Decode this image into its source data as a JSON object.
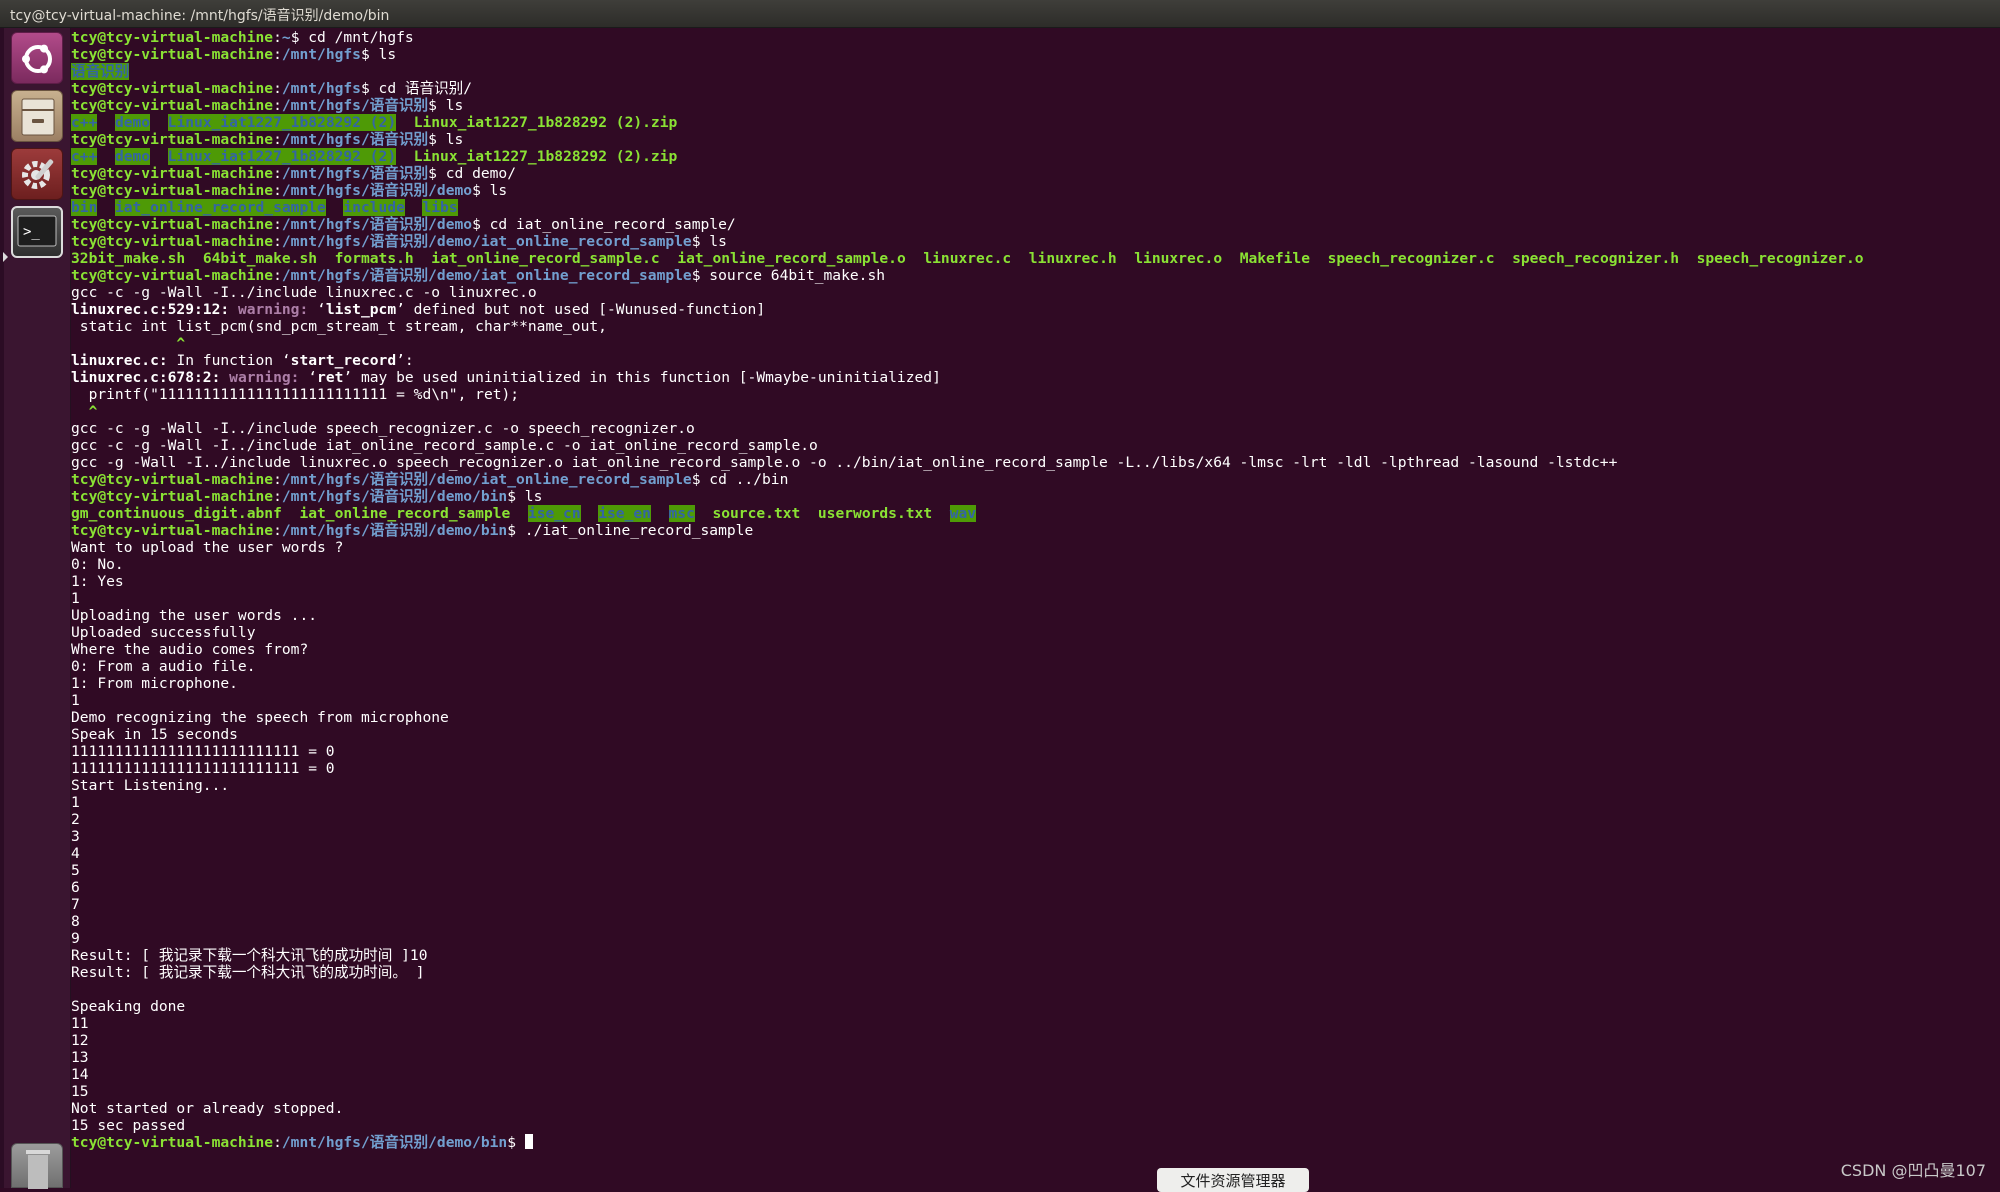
{
  "window": {
    "title": "tcy@tcy-virtual-machine: /mnt/hgfs/语音识别/demo/bin"
  },
  "launcher": {
    "items": [
      "Dash",
      "Files",
      "System Settings",
      "Terminal",
      "Trash"
    ]
  },
  "terminal": {
    "user": "tcy@tcy-virtual-machine",
    "lines": [
      [
        [
          "pu",
          "tcy@tcy-virtual-machine"
        ],
        [
          "",
          ""
        ],
        [
          "pp",
          "~"
        ],
        [
          "",
          "$ cd /mnt/hgfs"
        ]
      ],
      [
        [
          "pu",
          "tcy@tcy-virtual-machine"
        ],
        [
          "",
          ":"
        ],
        [
          "pp",
          "/mnt/hgfs"
        ],
        [
          "",
          "$ ls"
        ]
      ],
      [
        [
          "dirhl",
          "语音识别"
        ]
      ],
      [
        [
          "pu",
          "tcy@tcy-virtual-machine"
        ],
        [
          "",
          ":"
        ],
        [
          "pp",
          "/mnt/hgfs"
        ],
        [
          "",
          "$ cd 语音识别/"
        ]
      ],
      [
        [
          "pu",
          "tcy@tcy-virtual-machine"
        ],
        [
          "",
          ":"
        ],
        [
          "pp",
          "/mnt/hgfs/语音识别"
        ],
        [
          "",
          "$ ls"
        ]
      ],
      [
        [
          "dirhl",
          "c++"
        ],
        [
          "",
          "  "
        ],
        [
          "dirhl",
          "demo"
        ],
        [
          "",
          "  "
        ],
        [
          "dirhl",
          "Linux_iat1227_1b828292 (2)"
        ],
        [
          "",
          "  "
        ],
        [
          "ex",
          "Linux_iat1227_1b828292 (2).zip"
        ]
      ],
      [
        [
          "pu",
          "tcy@tcy-virtual-machine"
        ],
        [
          "",
          ":"
        ],
        [
          "pp",
          "/mnt/hgfs/语音识别"
        ],
        [
          "",
          "$ ls"
        ]
      ],
      [
        [
          "dirhl",
          "c++"
        ],
        [
          "",
          "  "
        ],
        [
          "dirhl",
          "demo"
        ],
        [
          "",
          "  "
        ],
        [
          "dirhl",
          "Linux_iat1227_1b828292 (2)"
        ],
        [
          "",
          "  "
        ],
        [
          "ex",
          "Linux_iat1227_1b828292 (2).zip"
        ]
      ],
      [
        [
          "pu",
          "tcy@tcy-virtual-machine"
        ],
        [
          "",
          ":"
        ],
        [
          "pp",
          "/mnt/hgfs/语音识别"
        ],
        [
          "",
          "$ cd demo/"
        ]
      ],
      [
        [
          "pu",
          "tcy@tcy-virtual-machine"
        ],
        [
          "",
          ":"
        ],
        [
          "pp",
          "/mnt/hgfs/语音识别/demo"
        ],
        [
          "",
          "$ ls"
        ]
      ],
      [
        [
          "dirhl",
          "bin"
        ],
        [
          "",
          "  "
        ],
        [
          "dirhl",
          "iat_online_record_sample"
        ],
        [
          "",
          "  "
        ],
        [
          "dirhl",
          "include"
        ],
        [
          "",
          "  "
        ],
        [
          "dirhl",
          "libs"
        ]
      ],
      [
        [
          "pu",
          "tcy@tcy-virtual-machine"
        ],
        [
          "",
          ":"
        ],
        [
          "pp",
          "/mnt/hgfs/语音识别/demo"
        ],
        [
          "",
          "$ cd iat_online_record_sample/"
        ]
      ],
      [
        [
          "pu",
          "tcy@tcy-virtual-machine"
        ],
        [
          "",
          ":"
        ],
        [
          "pp",
          "/mnt/hgfs/语音识别/demo/iat_online_record_sample"
        ],
        [
          "",
          "$ ls"
        ]
      ],
      [
        [
          "ex",
          "32bit_make.sh"
        ],
        [
          "",
          "  "
        ],
        [
          "ex",
          "64bit_make.sh"
        ],
        [
          "",
          "  "
        ],
        [
          "ex",
          "formats.h"
        ],
        [
          "",
          "  "
        ],
        [
          "ex",
          "iat_online_record_sample.c"
        ],
        [
          "",
          "  "
        ],
        [
          "ex",
          "iat_online_record_sample.o"
        ],
        [
          "",
          "  "
        ],
        [
          "ex",
          "linuxrec.c"
        ],
        [
          "",
          "  "
        ],
        [
          "ex",
          "linuxrec.h"
        ],
        [
          "",
          "  "
        ],
        [
          "ex",
          "linuxrec.o"
        ],
        [
          "",
          "  "
        ],
        [
          "ex",
          "Makefile"
        ],
        [
          "",
          "  "
        ],
        [
          "ex",
          "speech_recognizer.c"
        ],
        [
          "",
          "  "
        ],
        [
          "ex",
          "speech_recognizer.h"
        ],
        [
          "",
          "  "
        ],
        [
          "ex",
          "speech_recognizer.o"
        ]
      ],
      [
        [
          "pu",
          "tcy@tcy-virtual-machine"
        ],
        [
          "",
          ":"
        ],
        [
          "pp",
          "/mnt/hgfs/语音识别/demo/iat_online_record_sample"
        ],
        [
          "",
          "$ source 64bit_make.sh"
        ]
      ],
      [
        [
          "",
          "gcc -c -g -Wall -I../include linuxrec.c -o linuxrec.o"
        ]
      ],
      [
        [
          "bold",
          "linuxrec.c:529:12: "
        ],
        [
          "warn",
          "warning: "
        ],
        [
          "",
          "‘"
        ],
        [
          "bold",
          "list_pcm"
        ],
        [
          "",
          "’ defined but not used [-Wunused-function]"
        ]
      ],
      [
        [
          "",
          " static int list_pcm(snd_pcm_stream_t stream, char**name_out,"
        ]
      ],
      [
        [
          "caret",
          "            ^"
        ]
      ],
      [
        [
          "bold",
          "linuxrec.c:"
        ],
        [
          "",
          " In function ‘"
        ],
        [
          "bold",
          "start_record"
        ],
        [
          "",
          "’:"
        ]
      ],
      [
        [
          "bold",
          "linuxrec.c:678:2: "
        ],
        [
          "warn",
          "warning: "
        ],
        [
          "",
          "‘"
        ],
        [
          "bold",
          "ret"
        ],
        [
          "",
          "’ may be used uninitialized in this function [-Wmaybe-uninitialized]"
        ]
      ],
      [
        [
          "",
          "  printf(\"11111111111111111111111111 = %d\\n\", ret);"
        ]
      ],
      [
        [
          "caret",
          "  ^"
        ]
      ],
      [
        [
          "",
          "gcc -c -g -Wall -I../include speech_recognizer.c -o speech_recognizer.o"
        ]
      ],
      [
        [
          "",
          "gcc -c -g -Wall -I../include iat_online_record_sample.c -o iat_online_record_sample.o"
        ]
      ],
      [
        [
          "",
          "gcc -g -Wall -I../include linuxrec.o speech_recognizer.o iat_online_record_sample.o -o ../bin/iat_online_record_sample -L../libs/x64 -lmsc -lrt -ldl -lpthread -lasound -lstdc++"
        ]
      ],
      [
        [
          "pu",
          "tcy@tcy-virtual-machine"
        ],
        [
          "",
          ":"
        ],
        [
          "pp",
          "/mnt/hgfs/语音识别/demo/iat_online_record_sample"
        ],
        [
          "",
          "$ cd ../bin"
        ]
      ],
      [
        [
          "pu",
          "tcy@tcy-virtual-machine"
        ],
        [
          "",
          ":"
        ],
        [
          "pp",
          "/mnt/hgfs/语音识别/demo/bin"
        ],
        [
          "",
          "$ ls"
        ]
      ],
      [
        [
          "ex",
          "gm_continuous_digit.abnf"
        ],
        [
          "",
          "  "
        ],
        [
          "ex",
          "iat_online_record_sample"
        ],
        [
          "",
          "  "
        ],
        [
          "dirhl",
          "ise_cn"
        ],
        [
          "",
          "  "
        ],
        [
          "dirhl",
          "ise_en"
        ],
        [
          "",
          "  "
        ],
        [
          "dirhl",
          "msc"
        ],
        [
          "",
          "  "
        ],
        [
          "ex",
          "source.txt"
        ],
        [
          "",
          "  "
        ],
        [
          "ex",
          "userwords.txt"
        ],
        [
          "",
          "  "
        ],
        [
          "dirhl",
          "wav"
        ]
      ],
      [
        [
          "pu",
          "tcy@tcy-virtual-machine"
        ],
        [
          "",
          ":"
        ],
        [
          "pp",
          "/mnt/hgfs/语音识别/demo/bin"
        ],
        [
          "",
          "$ ./iat_online_record_sample"
        ]
      ],
      [
        [
          "",
          "Want to upload the user words ?"
        ]
      ],
      [
        [
          "",
          "0: No."
        ]
      ],
      [
        [
          "",
          "1: Yes"
        ]
      ],
      [
        [
          "",
          "1"
        ]
      ],
      [
        [
          "",
          "Uploading the user words ..."
        ]
      ],
      [
        [
          "",
          "Uploaded successfully"
        ]
      ],
      [
        [
          "",
          "Where the audio comes from?"
        ]
      ],
      [
        [
          "",
          "0: From a audio file."
        ]
      ],
      [
        [
          "",
          "1: From microphone."
        ]
      ],
      [
        [
          "",
          "1"
        ]
      ],
      [
        [
          "",
          "Demo recognizing the speech from microphone"
        ]
      ],
      [
        [
          "",
          "Speak in 15 seconds"
        ]
      ],
      [
        [
          "",
          "11111111111111111111111111 = 0"
        ]
      ],
      [
        [
          "",
          "11111111111111111111111111 = 0"
        ]
      ],
      [
        [
          "",
          "Start Listening..."
        ]
      ],
      [
        [
          "",
          "1"
        ]
      ],
      [
        [
          "",
          "2"
        ]
      ],
      [
        [
          "",
          "3"
        ]
      ],
      [
        [
          "",
          "4"
        ]
      ],
      [
        [
          "",
          "5"
        ]
      ],
      [
        [
          "",
          "6"
        ]
      ],
      [
        [
          "",
          "7"
        ]
      ],
      [
        [
          "",
          "8"
        ]
      ],
      [
        [
          "",
          "9"
        ]
      ],
      [
        [
          "",
          "Result: [ 我记录下载一个科大讯飞的成功时间 ]10"
        ]
      ],
      [
        [
          "",
          "Result: [ 我记录下载一个科大讯飞的成功时间。 ]"
        ]
      ],
      [
        [
          "",
          ""
        ]
      ],
      [
        [
          "",
          "Speaking done"
        ]
      ],
      [
        [
          "",
          "11"
        ]
      ],
      [
        [
          "",
          "12"
        ]
      ],
      [
        [
          "",
          "13"
        ]
      ],
      [
        [
          "",
          "14"
        ]
      ],
      [
        [
          "",
          "15"
        ]
      ],
      [
        [
          "",
          "Not started or already stopped."
        ]
      ],
      [
        [
          "",
          "15 sec passed"
        ]
      ],
      [
        [
          "pu",
          "tcy@tcy-virtual-machine"
        ],
        [
          "",
          ":"
        ],
        [
          "pp",
          "/mnt/hgfs/语音识别/demo/bin"
        ],
        [
          "",
          "$ "
        ]
      ]
    ]
  },
  "tooltip": {
    "text": "文件资源管理器"
  },
  "watermark": {
    "text": "CSDN @凹凸曼107"
  },
  "colors": {
    "background": "#300a24",
    "prompt_user": "#8ae234",
    "prompt_path": "#729fcf",
    "dir_highlight_bg": "#4e9a06",
    "dir_highlight_fg": "#3465a4",
    "warning": "#ad7fa8"
  }
}
